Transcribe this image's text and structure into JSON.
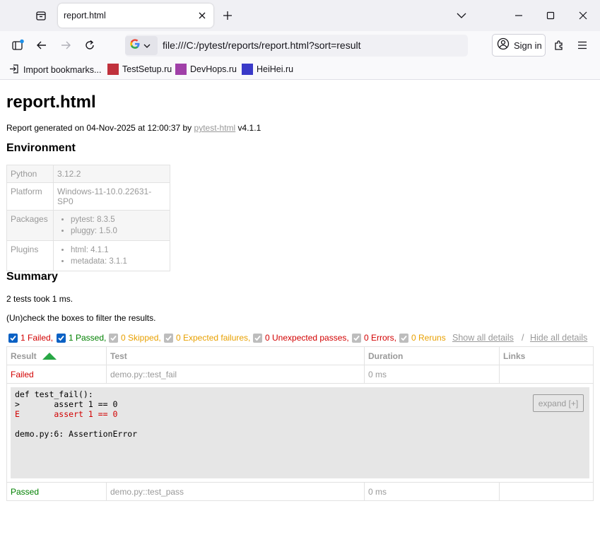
{
  "browser": {
    "tab_title": "report.html",
    "url": "file:///C:/pytest/reports/report.html?sort=result",
    "sign_in_label": "Sign in",
    "bookmarks": [
      {
        "label": "Import bookmarks...",
        "color": ""
      },
      {
        "label": "TestSetup.ru",
        "color": "#c0313c"
      },
      {
        "label": "DevHops.ru",
        "color": "#a040a8"
      },
      {
        "label": "HeiHei.ru",
        "color": "#3a3ac8"
      }
    ]
  },
  "report": {
    "title": "report.html",
    "generated_prefix": "Report generated on 04-Nov-2025 at 12:00:37 by ",
    "generator_link": "pytest-html",
    "generator_version": " v4.1.1",
    "environment_heading": "Environment",
    "environment": {
      "python_key": "Python",
      "python_val": "3.12.2",
      "platform_key": "Platform",
      "platform_val": "Windows-11-10.0.22631-SP0",
      "packages_key": "Packages",
      "packages": [
        "pytest: 8.3.5",
        "pluggy: 1.5.0"
      ],
      "plugins_key": "Plugins",
      "plugins": [
        "html: 4.1.1",
        "metadata: 3.1.1"
      ]
    },
    "summary_heading": "Summary",
    "summary_text": "2 tests took 1 ms.",
    "filter_hint": "(Un)check the boxes to filter the results.",
    "filters": [
      {
        "label": "1 Failed,",
        "checked": true,
        "color": "#d20000"
      },
      {
        "label": "1 Passed,",
        "checked": true,
        "color": "#008000"
      },
      {
        "label": "0 Skipped,",
        "checked": false,
        "color": "#e8a000"
      },
      {
        "label": "0 Expected failures,",
        "checked": false,
        "color": "#e8a000"
      },
      {
        "label": "0 Unexpected passes,",
        "checked": false,
        "color": "#d20000"
      },
      {
        "label": "0 Errors,",
        "checked": false,
        "color": "#d20000"
      },
      {
        "label": "0 Reruns",
        "checked": false,
        "color": "#e8a000"
      }
    ],
    "show_all_details": "Show all details",
    "separator": "/",
    "hide_all_details": "Hide all details",
    "columns": [
      "Result",
      "Test",
      "Duration",
      "Links"
    ],
    "rows": [
      {
        "result": "Failed",
        "test": "demo.py::test_fail",
        "duration": "0 ms",
        "links": "",
        "log_lines": [
          {
            "text": "def test_fail():",
            "error": false
          },
          {
            "text": ">       assert 1 == 0",
            "error": false
          },
          {
            "text": "E       assert 1 == 0",
            "error": true
          },
          {
            "text": "",
            "error": false
          },
          {
            "text": "demo.py:6: AssertionError",
            "error": false
          }
        ],
        "expand_label": "expand [+]"
      },
      {
        "result": "Passed",
        "test": "demo.py::test_pass",
        "duration": "0 ms",
        "links": ""
      }
    ]
  }
}
